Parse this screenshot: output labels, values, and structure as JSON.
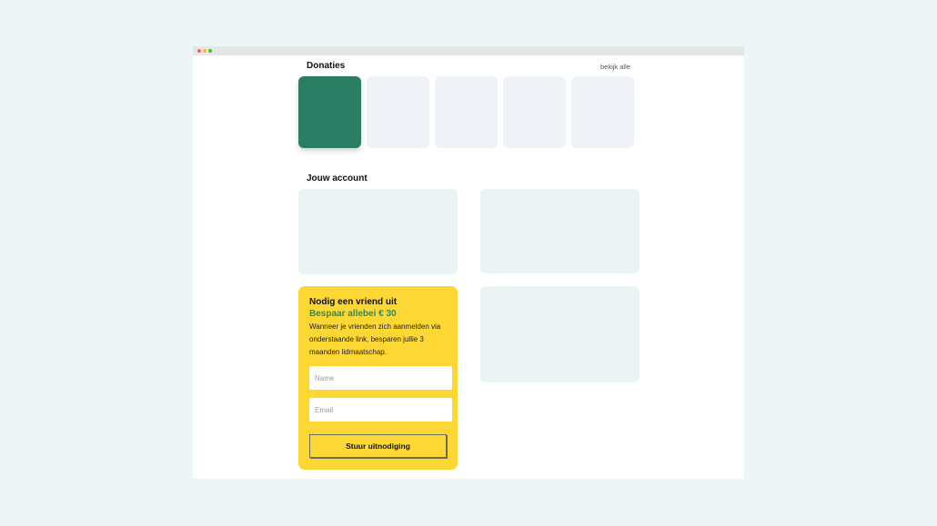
{
  "colors": {
    "page_background": "#eef5f7",
    "window_background": "#ffffff",
    "titlebar": "#e6e6e6",
    "traffic_light_red": "#ff5f57",
    "traffic_light_yellow": "#febc2e",
    "traffic_light_green": "#28c840",
    "donation_active": "#2b7e64",
    "donation_placeholder": "#eff3f7",
    "account_placeholder": "#ebf3f5",
    "invite_background": "#fdd835",
    "invite_accent": "#2b8a62"
  },
  "donations": {
    "title": "Donaties",
    "view_all": "bekijk alle"
  },
  "account": {
    "title": "Jouw account"
  },
  "invite": {
    "title": "Nodig een vriend uit",
    "subtitle": "Bespaar allebei € 30",
    "description": "Wanneer je vrienden zich aanmelden via onderstaande link, besparen jullie 3 maanden lidmaatschap.",
    "name_placeholder": "Name",
    "email_placeholder": "Email",
    "button_label": "Stuur uitnodiging"
  }
}
